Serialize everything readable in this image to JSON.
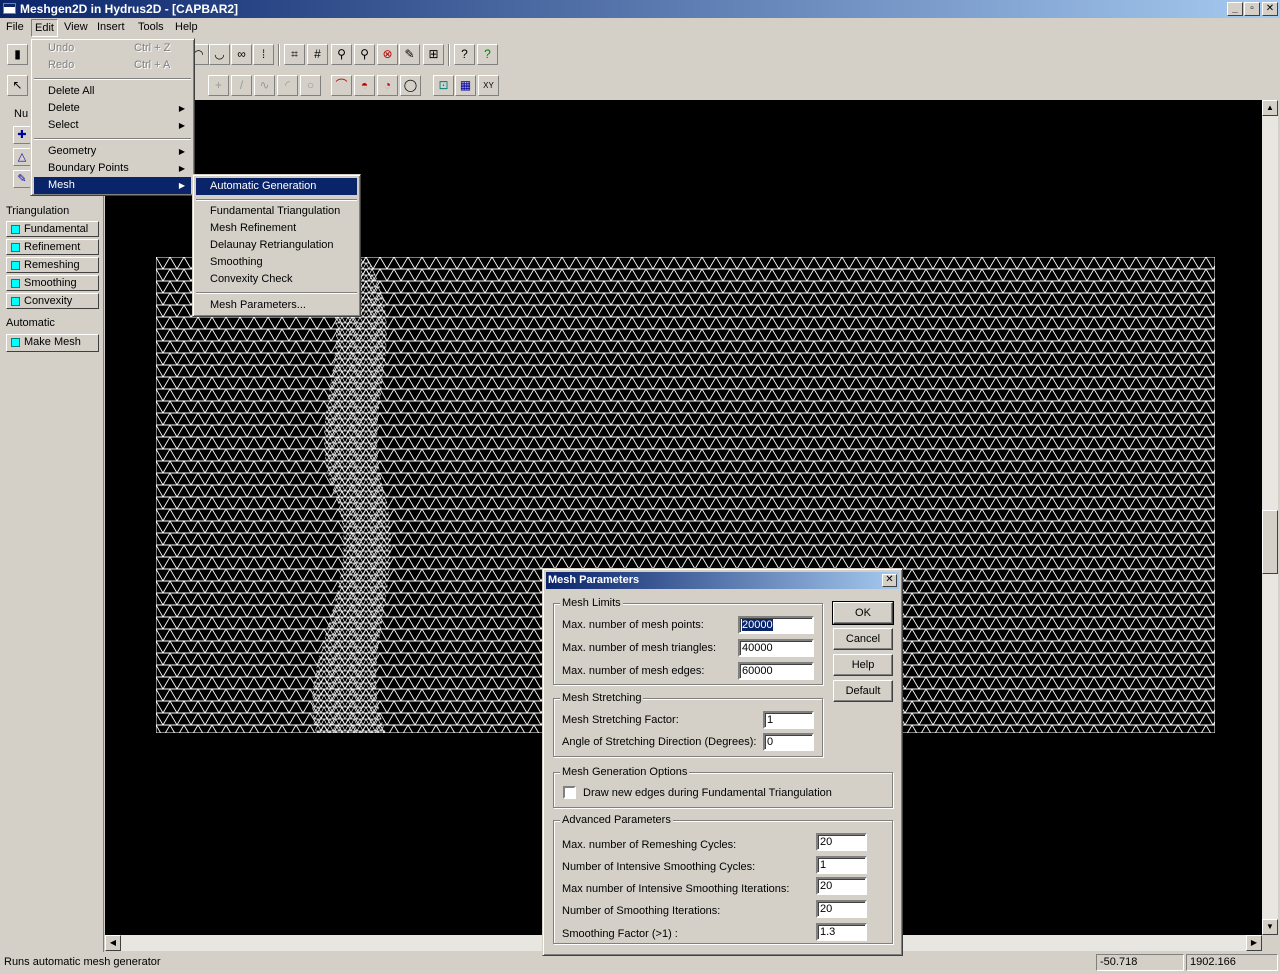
{
  "window": {
    "title": "Meshgen2D in Hydrus2D - [CAPBAR2]",
    "buttons": [
      "_",
      "▫",
      "✕"
    ]
  },
  "menubar": {
    "items": [
      "File",
      "Edit",
      "View",
      "Insert",
      "Tools",
      "Help"
    ]
  },
  "edit_menu": {
    "undo": "Undo",
    "undo_shortcut": "Ctrl + Z",
    "redo": "Redo",
    "redo_shortcut": "Ctrl + A",
    "delete_all": "Delete All",
    "delete": "Delete",
    "select": "Select",
    "geometry": "Geometry",
    "boundary_points": "Boundary Points",
    "mesh": "Mesh"
  },
  "mesh_submenu": {
    "automatic_generation": "Automatic Generation",
    "fundamental_triangulation": "Fundamental Triangulation",
    "mesh_refinement": "Mesh Refinement",
    "delaunay_retriangulation": "Delaunay Retriangulation",
    "smoothing": "Smoothing",
    "convexity_check": "Convexity Check",
    "mesh_parameters": "Mesh Parameters..."
  },
  "left_panel": {
    "nu_label": "Nu",
    "triangulation_label": "Triangulation",
    "buttons": [
      "Fundamental",
      "Refinement",
      "Remeshing",
      "Smoothing",
      "Convexity"
    ],
    "automatic_label": "Automatic",
    "make_mesh": "Make Mesh"
  },
  "dialog": {
    "title": "Mesh Parameters",
    "close": "✕",
    "mesh_limits": {
      "title": "Mesh Limits",
      "points_label": "Max. number of mesh points:",
      "points_value": "20000",
      "triangles_label": "Max. number of mesh triangles:",
      "triangles_value": "40000",
      "edges_label": "Max. number of mesh edges:",
      "edges_value": "60000"
    },
    "mesh_stretching": {
      "title": "Mesh Stretching",
      "factor_label": "Mesh Stretching Factor:",
      "factor_value": "1",
      "angle_label": "Angle of Stretching Direction (Degrees):",
      "angle_value": "0"
    },
    "generation_options": {
      "title": "Mesh Generation Options",
      "draw_edges_label": "Draw new edges during Fundamental Triangulation",
      "draw_edges_checked": false
    },
    "advanced": {
      "title": "Advanced Parameters",
      "remeshing_label": "Max. number of Remeshing Cycles:",
      "remeshing_value": "20",
      "intensive_cycles_label": "Number of Intensive Smoothing Cycles:",
      "intensive_cycles_value": "1",
      "intensive_iter_label": "Max number of Intensive Smoothing Iterations:",
      "intensive_iter_value": "20",
      "smoothing_iter_label": "Number of Smoothing Iterations:",
      "smoothing_iter_value": "20",
      "smoothing_factor_label": "Smoothing Factor (>1) :",
      "smoothing_factor_value": "1.3"
    },
    "buttons": {
      "ok": "OK",
      "cancel": "Cancel",
      "help": "Help",
      "default": "Default"
    }
  },
  "statusbar": {
    "message": "Runs automatic mesh generator",
    "x": "-50.718",
    "y": "1902.166"
  },
  "colors": {
    "titlebar_start": "#0a246a",
    "titlebar_end": "#a6caf0",
    "canvas": "#000000",
    "mesh": "#ffffff",
    "highlight": "#0a246a",
    "accent_square": "#00ffff"
  }
}
